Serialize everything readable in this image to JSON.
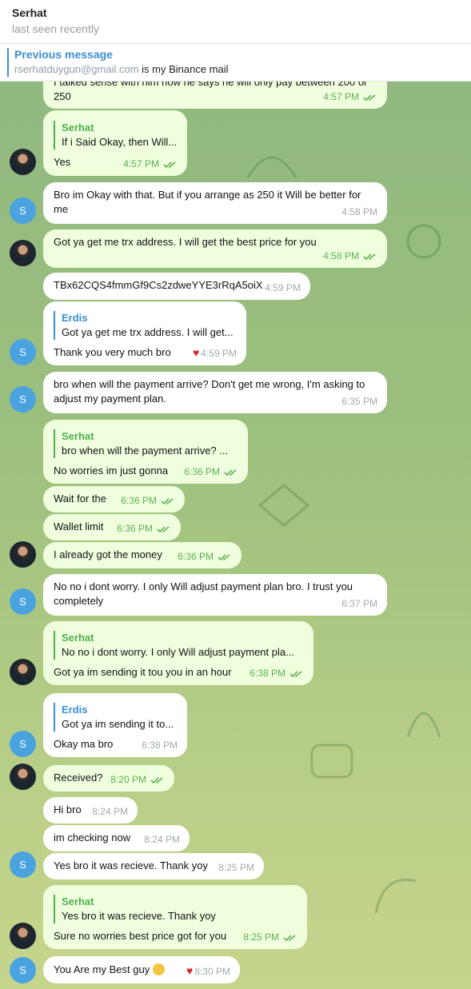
{
  "header": {
    "name": "Serhat",
    "status": "last seen recently"
  },
  "pinned": {
    "title": "Previous message",
    "link": "rserhatduygun@gmail.com",
    "text": " is my Binance mail"
  },
  "avatar_letter": "S",
  "messages": [
    {
      "text": "I talked sense with him now he says he will only pay between 200 or 250",
      "time": "4:57 PM"
    },
    {
      "reply_name": "Serhat",
      "reply_text": "If i Said Okay, then Will...",
      "text": "Yes",
      "time": "4:57 PM"
    },
    {
      "text": "Bro im Okay with that. But if you arrange as 250 it Will be better for me",
      "time": "4:58 PM"
    },
    {
      "text": "Got ya get me trx address. I will get the best price for you",
      "time": "4:58 PM"
    },
    {
      "text": "TBx62CQS4fmmGf9Cs2zdweYYE3rRqA5oiX",
      "time": "4:59 PM"
    },
    {
      "reply_name": "Erdis",
      "reply_text": "Got ya get me trx address. I will get...",
      "text": "Thank you very much bro",
      "time": "4:59 PM"
    },
    {
      "text": "bro when will the payment arrive?  Don't get me wrong, I'm asking to adjust my payment plan.",
      "time": "6:35 PM"
    },
    {
      "reply_name": "Serhat",
      "reply_text": "bro when will the payment arrive?  ...",
      "text": "No worries im just gonna",
      "time": "6:36 PM"
    },
    {
      "text": "Wait for the",
      "time": "6:36 PM"
    },
    {
      "text": "Wallet limit",
      "time": "6:36 PM"
    },
    {
      "text": "I already got the money",
      "time": "6:36 PM"
    },
    {
      "text": "No no i dont worry. I only Will adjust payment plan bro. I trust you completely",
      "time": "6:37 PM"
    },
    {
      "reply_name": "Serhat",
      "reply_text": "No no i dont worry. I only Will adjust payment pla...",
      "text": "Got ya im sending it tou you in an hour",
      "time": "6:38 PM"
    },
    {
      "reply_name": "Erdis",
      "reply_text": "Got ya im sending it to...",
      "text": "Okay ma bro",
      "time": "6:38 PM"
    },
    {
      "text": "Received?",
      "time": "8:20 PM"
    },
    {
      "text": "Hi bro",
      "time": "8:24 PM"
    },
    {
      "text": "im checking now",
      "time": "8:24 PM"
    },
    {
      "text": "Yes bro it was recieve. Thank yoy",
      "time": "8:25 PM"
    },
    {
      "reply_name": "Serhat",
      "reply_text": "Yes bro it was recieve. Thank yoy",
      "text": "Sure no worries best price got for you",
      "time": "8:25 PM"
    },
    {
      "text": "You Are my Best guy",
      "time": "8:30 PM"
    }
  ]
}
